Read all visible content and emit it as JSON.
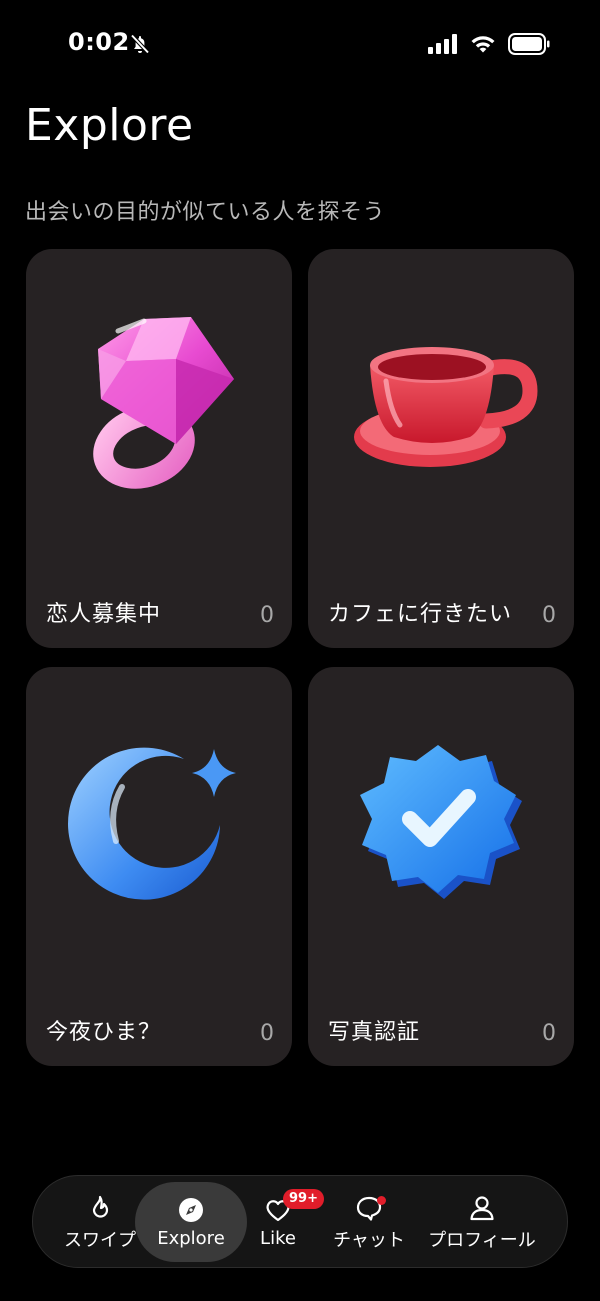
{
  "status_bar": {
    "time": "0:02",
    "icons": [
      "bell-slash-icon",
      "signal-icon",
      "wifi-icon",
      "battery-icon"
    ]
  },
  "header": {
    "title": "Explore",
    "subtitle": "出会いの目的が似ている人を探そう"
  },
  "cards": [
    {
      "label": "恋人募集中",
      "count": "0",
      "icon": "diamond-ring-icon"
    },
    {
      "label": "カフェに行きたい",
      "count": "0",
      "icon": "teacup-icon"
    },
    {
      "label": "今夜ひま？",
      "count": "0",
      "icon": "crescent-moon-icon"
    },
    {
      "label": "写真認証",
      "count": "0",
      "icon": "verified-badge-icon"
    }
  ],
  "bottom_nav": {
    "items": [
      {
        "label": "スワイプ",
        "icon": "flame-icon",
        "active": false
      },
      {
        "label": "Explore",
        "icon": "compass-icon",
        "active": true
      },
      {
        "label": "Like",
        "icon": "heart-icon",
        "active": false,
        "badge": "99+"
      },
      {
        "label": "チャット",
        "icon": "chat-bubble-icon",
        "active": false,
        "dot": true
      },
      {
        "label": "プロフィール",
        "icon": "person-icon",
        "active": false
      }
    ]
  },
  "colors": {
    "background": "#000000",
    "card": "#262223",
    "badge": "#e11d2a",
    "nav_active": "#3a3a3a"
  }
}
